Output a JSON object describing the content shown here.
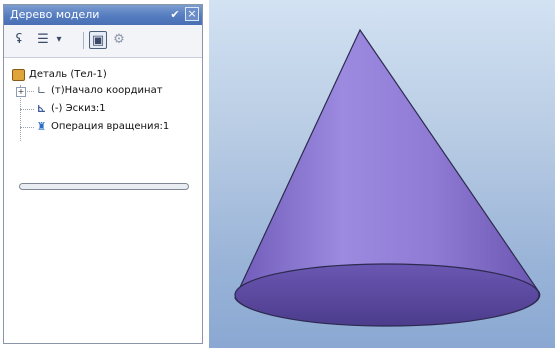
{
  "panel": {
    "title": "Дерево модели",
    "pin_glyph": "✔",
    "close_glyph": "×"
  },
  "toolbar": {
    "buttons": [
      {
        "icon": "tree-build-icon",
        "glyph": "ʢ"
      },
      {
        "icon": "tree-list-icon",
        "glyph": "☰"
      },
      {
        "icon": "dropdown-arrow-icon",
        "glyph": "▾"
      },
      {
        "icon": "details-icon",
        "glyph": "▣"
      },
      {
        "icon": "properties-icon",
        "glyph": "⚙"
      }
    ]
  },
  "tree": {
    "root": {
      "label": "Деталь (Тел-1)",
      "icon": "part-icon"
    },
    "items": [
      {
        "label": "(т)Начало координат",
        "icon": "origin-icon",
        "expandable": true
      },
      {
        "label": "(-) Эскиз:1",
        "icon": "sketch-icon",
        "expandable": false
      },
      {
        "label": "Операция вращения:1",
        "icon": "revolve-icon",
        "expandable": false
      }
    ]
  },
  "viewport": {
    "model": "cone",
    "colors": {
      "cone_light": "#9a86d8",
      "cone_dark": "#6b56b0",
      "base": "#5b49a0",
      "edge": "#2d2a4f"
    }
  }
}
